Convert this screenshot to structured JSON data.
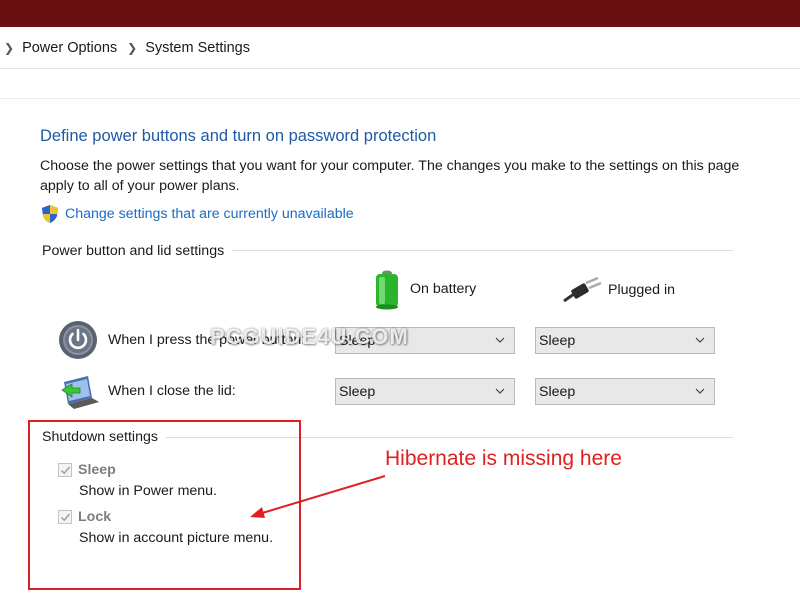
{
  "breadcrumb": {
    "items": [
      "Power Options",
      "System Settings"
    ]
  },
  "page": {
    "title": "Define power buttons and turn on password protection",
    "description": "Choose the power settings that you want for your computer. The changes you make to the settings on this page apply to all of your power plans.",
    "change_link": "Change settings that are currently unavailable"
  },
  "power_section": {
    "title": "Power button and lid settings",
    "col_battery": "On battery",
    "col_plugged": "Plugged in",
    "rows": [
      {
        "label": "When I press the power button:",
        "battery": "Sleep",
        "plugged": "Sleep"
      },
      {
        "label": "When I close the lid:",
        "battery": "Sleep",
        "plugged": "Sleep"
      }
    ]
  },
  "shutdown_section": {
    "title": "Shutdown settings",
    "items": [
      {
        "label": "Sleep",
        "sub": "Show in Power menu.",
        "checked": true
      },
      {
        "label": "Lock",
        "sub": "Show in account picture menu.",
        "checked": true
      }
    ]
  },
  "annotation": {
    "text": "Hibernate is missing here",
    "color": "#e02020"
  },
  "watermark": "PCGUIDE4U.COM",
  "colors": {
    "titlebar": "#6b1010",
    "heading": "#1e5aa6",
    "link": "#1c6bc4"
  }
}
